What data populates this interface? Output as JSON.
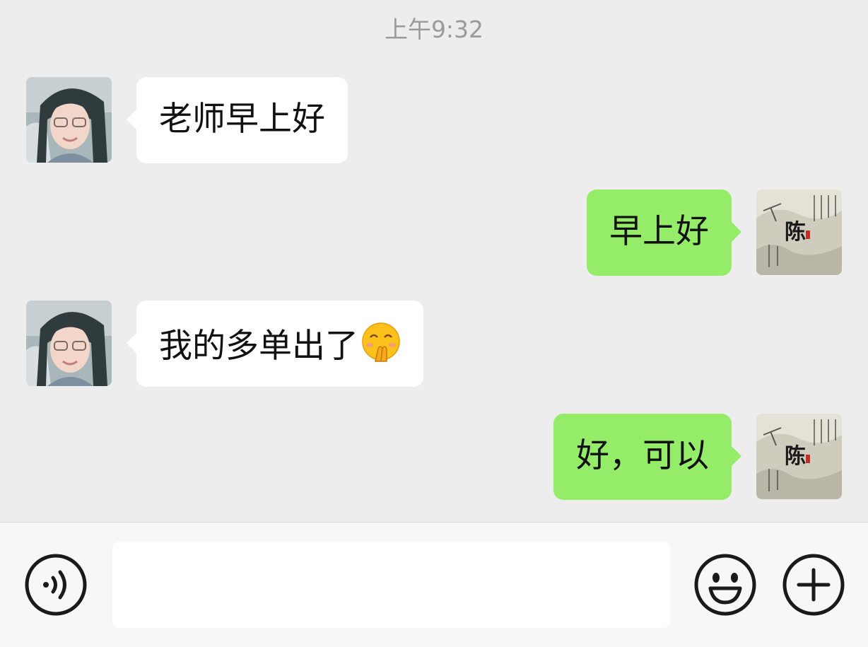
{
  "chat": {
    "timestamp": "上午9:32",
    "messages": [
      {
        "side": "in",
        "text": "老师早上好"
      },
      {
        "side": "out",
        "text": "早上好"
      },
      {
        "side": "in",
        "text": "我的多单出了",
        "emoji": "shushing-face-emoji"
      },
      {
        "side": "out",
        "text": "好，可以"
      }
    ],
    "self_avatar_text": "陈"
  },
  "input_bar": {
    "value": "",
    "voice_icon": "voice-icon",
    "emoji_icon": "smiley-icon",
    "more_icon": "plus-icon"
  },
  "colors": {
    "background": "#ededed",
    "incoming_bubble": "#ffffff",
    "outgoing_bubble": "#95ec69",
    "timestamp": "#9a9a9a"
  }
}
